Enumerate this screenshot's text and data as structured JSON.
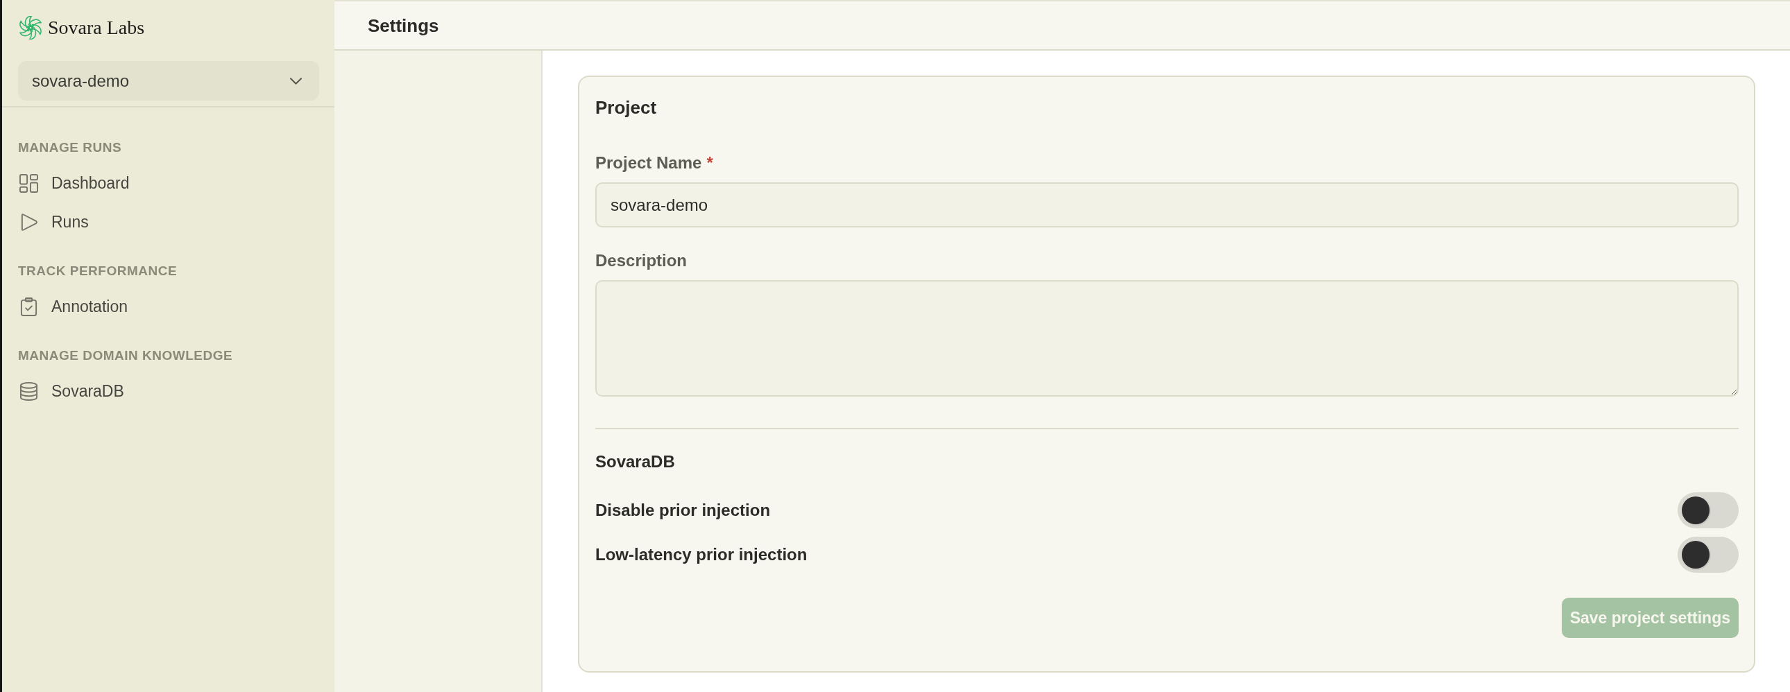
{
  "sidebar": {
    "brand": "Sovara Labs",
    "project_selector": {
      "value": "sovara-demo"
    },
    "sections": [
      {
        "title": "MANAGE RUNS",
        "items": [
          {
            "label": "Dashboard",
            "selected": false
          },
          {
            "label": "Runs",
            "selected": false
          }
        ]
      },
      {
        "title": "TRACK PERFORMANCE",
        "items": [
          {
            "label": "Annotation",
            "selected": false
          }
        ]
      },
      {
        "title": "MANAGE DOMAIN KNOWLEDGE",
        "items": [
          {
            "label": "SovaraDB",
            "selected": false
          }
        ]
      }
    ]
  },
  "header": {
    "title": "Settings"
  },
  "project_card": {
    "title": "Project",
    "fields": [
      {
        "kind": "text",
        "label": "Project Name",
        "required_mark": "*",
        "value": "sovara-demo"
      },
      {
        "kind": "textarea",
        "label": "Description"
      }
    ],
    "sovaradb": {
      "title": "SovaraDB",
      "toggles": [
        {
          "label": "Disable prior injection",
          "on": false
        },
        {
          "label": "Low-latency prior injection",
          "on": false
        }
      ]
    },
    "save_button": {
      "label": "Save project settings",
      "disabled": true
    }
  }
}
